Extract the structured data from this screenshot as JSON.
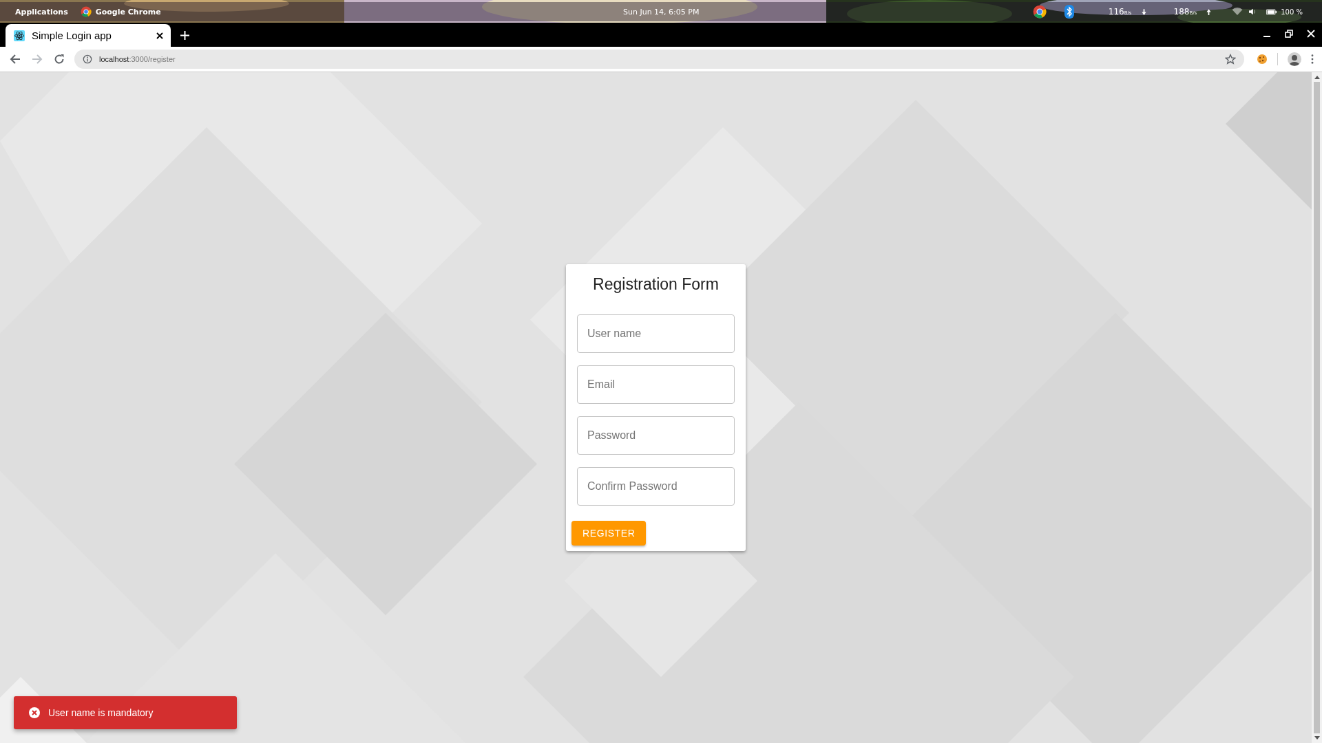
{
  "system_bar": {
    "apps_menu": "Applications",
    "active_app": "Google Chrome",
    "clock": "Sun Jun 14, 6:05 PM",
    "download_speed": "116",
    "download_unit": "B/s",
    "upload_speed": "188",
    "upload_unit": "B/s",
    "battery": "100 %"
  },
  "browser": {
    "tabs": [
      {
        "title": "Simple Login app",
        "selected": true
      }
    ],
    "url_host": "localhost",
    "url_path": ":3000/register"
  },
  "form": {
    "title": "Registration Form",
    "fields": [
      {
        "placeholder": "User name"
      },
      {
        "placeholder": "Email"
      },
      {
        "placeholder": "Password"
      },
      {
        "placeholder": "Confirm Password"
      }
    ],
    "submit": "REGISTER"
  },
  "toast": {
    "kind": "error",
    "message": "User name is mandatory"
  }
}
